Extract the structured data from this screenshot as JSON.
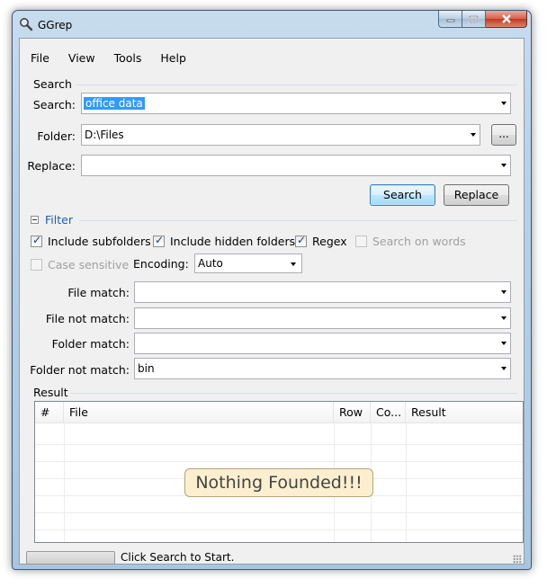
{
  "window": {
    "title": "GGrep"
  },
  "menu": [
    "File",
    "View",
    "Tools",
    "Help"
  ],
  "search_group": {
    "title": "Search",
    "search_label": "Search:",
    "search_value": "office data",
    "folder_label": "Folder:",
    "folder_value": "D:\\Files",
    "browse_label": "...",
    "replace_label": "Replace:",
    "replace_value": "",
    "search_button": "Search",
    "replace_button": "Replace"
  },
  "filter_group": {
    "title": "Filter",
    "include_subfolders": {
      "label": "Include subfolders",
      "checked": true
    },
    "include_hidden": {
      "label": "Include hidden folders",
      "checked": true
    },
    "regex": {
      "label": "Regex",
      "checked": true
    },
    "search_on_words": {
      "label": "Search on words",
      "checked": false
    },
    "case_sensitive": {
      "label": "Case sensitive",
      "checked": false
    },
    "encoding_label": "Encoding:",
    "encoding_value": "Auto",
    "file_match_label": "File match:",
    "file_match_value": "",
    "file_not_match_label": "File not match:",
    "file_not_match_value": "",
    "folder_match_label": "Folder match:",
    "folder_match_value": "",
    "folder_not_match_label": "Folder not match:",
    "folder_not_match_value": "bin"
  },
  "result_group": {
    "title": "Result",
    "columns": [
      "#",
      "File",
      "Row",
      "Co...",
      "Result"
    ],
    "empty_message": "Nothing Founded!!!"
  },
  "status": {
    "text": "Click Search to Start.",
    "progress": 0
  },
  "colors": {
    "accent": "#3399ff",
    "empty_bg": "#fcefcf",
    "filter_title": "#1a5fb4"
  }
}
